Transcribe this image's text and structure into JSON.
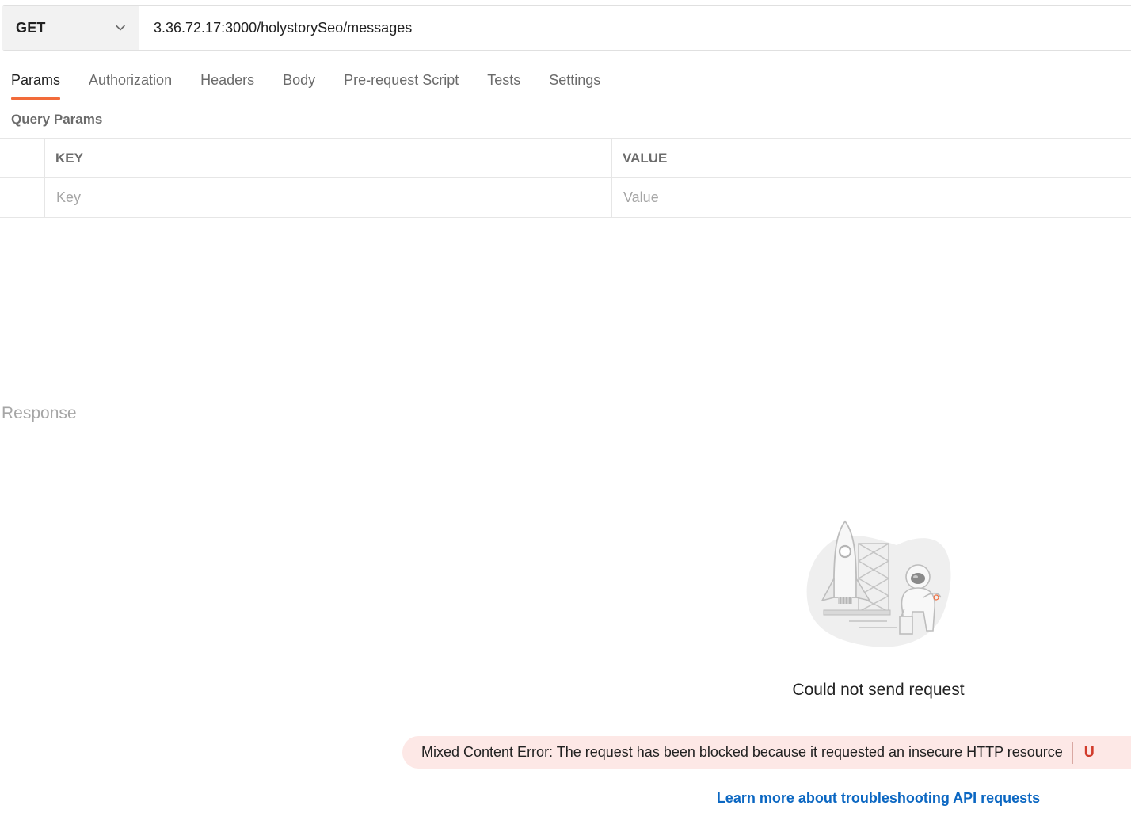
{
  "request": {
    "method": "GET",
    "url": "3.36.72.17:3000/holystorySeo/messages"
  },
  "tabs": [
    {
      "label": "Params",
      "active": true
    },
    {
      "label": "Authorization",
      "active": false
    },
    {
      "label": "Headers",
      "active": false
    },
    {
      "label": "Body",
      "active": false
    },
    {
      "label": "Pre-request Script",
      "active": false
    },
    {
      "label": "Tests",
      "active": false
    },
    {
      "label": "Settings",
      "active": false
    }
  ],
  "query_params": {
    "section_label": "Query Params",
    "columns": {
      "key": "KEY",
      "value": "VALUE"
    },
    "placeholders": {
      "key": "Key",
      "value": "Value"
    }
  },
  "response": {
    "label": "Response",
    "error_title": "Could not send request",
    "error_message": "Mixed Content Error: The request has been blocked because it requested an insecure HTTP resource",
    "action_label": "U",
    "learn_more": "Learn more about troubleshooting API requests"
  },
  "colors": {
    "accent": "#f26b3a",
    "link": "#0b67c2",
    "error_bg": "#fde8e6",
    "error_action": "#d13b2b"
  },
  "icons": {
    "method_dropdown": "chevron-down-icon",
    "illustration": "rocket-astronaut-illustration"
  }
}
